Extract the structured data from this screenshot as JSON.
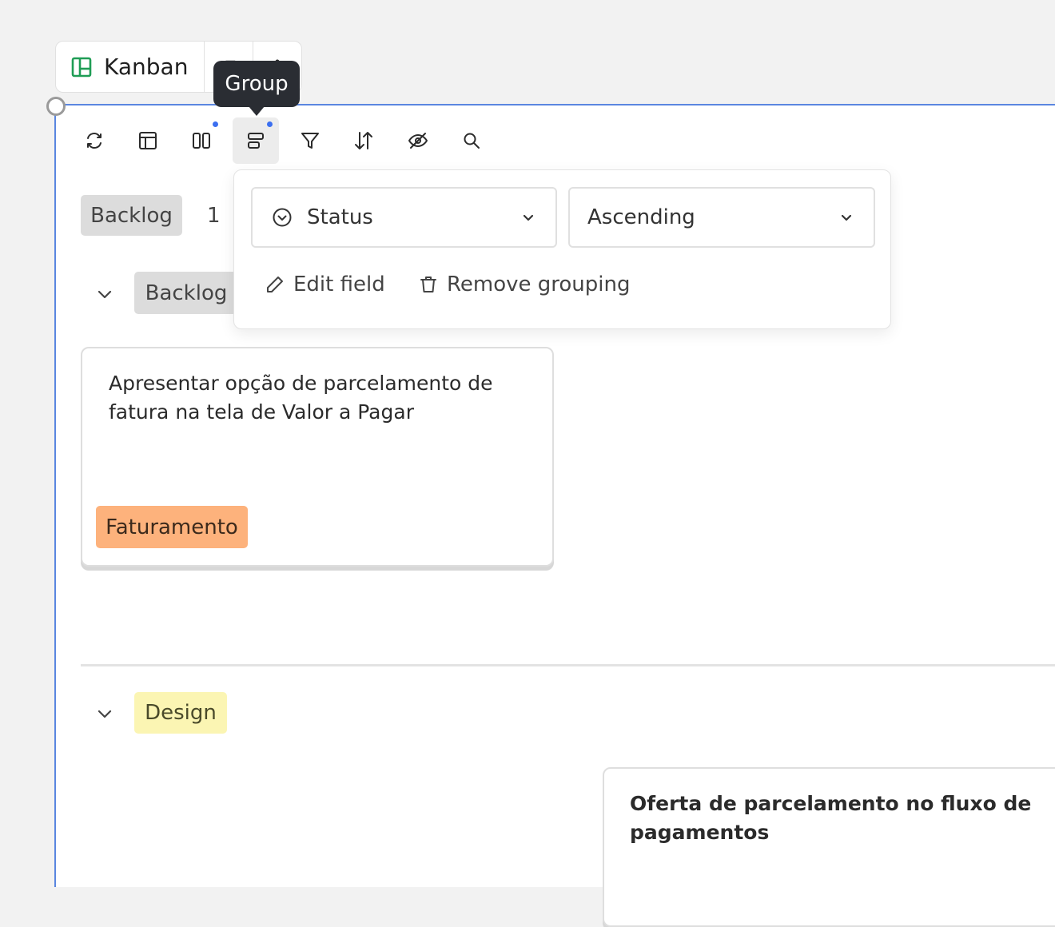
{
  "view_tab": {
    "label": "Kanban",
    "icon": "kanban-icon",
    "accent": "#1f9d55"
  },
  "tooltip": {
    "text": "Group"
  },
  "toolbar": {
    "buttons": [
      "refresh-icon",
      "layout-icon",
      "columns-icon",
      "group-icon",
      "filter-icon",
      "sort-icon",
      "hide-icon",
      "search-icon"
    ],
    "active": "group-icon",
    "indicator_color": "#3b6ff0"
  },
  "board": {
    "column_tag": "Backlog",
    "column_count": "1",
    "groups": [
      {
        "label": "Backlog",
        "color": "#dcdcdc",
        "cards": [
          {
            "title_line1": "Apresentar opção de parcelamento de",
            "title_line2": "fatura na tela de Valor a Pagar",
            "tag": "Faturamento",
            "tag_color": "#fdb27c"
          }
        ]
      },
      {
        "label": "Design",
        "color": "#fbf5b3",
        "cards": [
          {
            "title_line1": "Oferta de parcelamento no fluxo de",
            "title_line2": "pagamentos"
          }
        ]
      }
    ]
  },
  "group_popover": {
    "field": {
      "icon": "status-circle-check-icon",
      "value": "Status"
    },
    "order": {
      "value": "Ascending"
    },
    "edit_field_label": "Edit field",
    "remove_grouping_label": "Remove grouping"
  }
}
